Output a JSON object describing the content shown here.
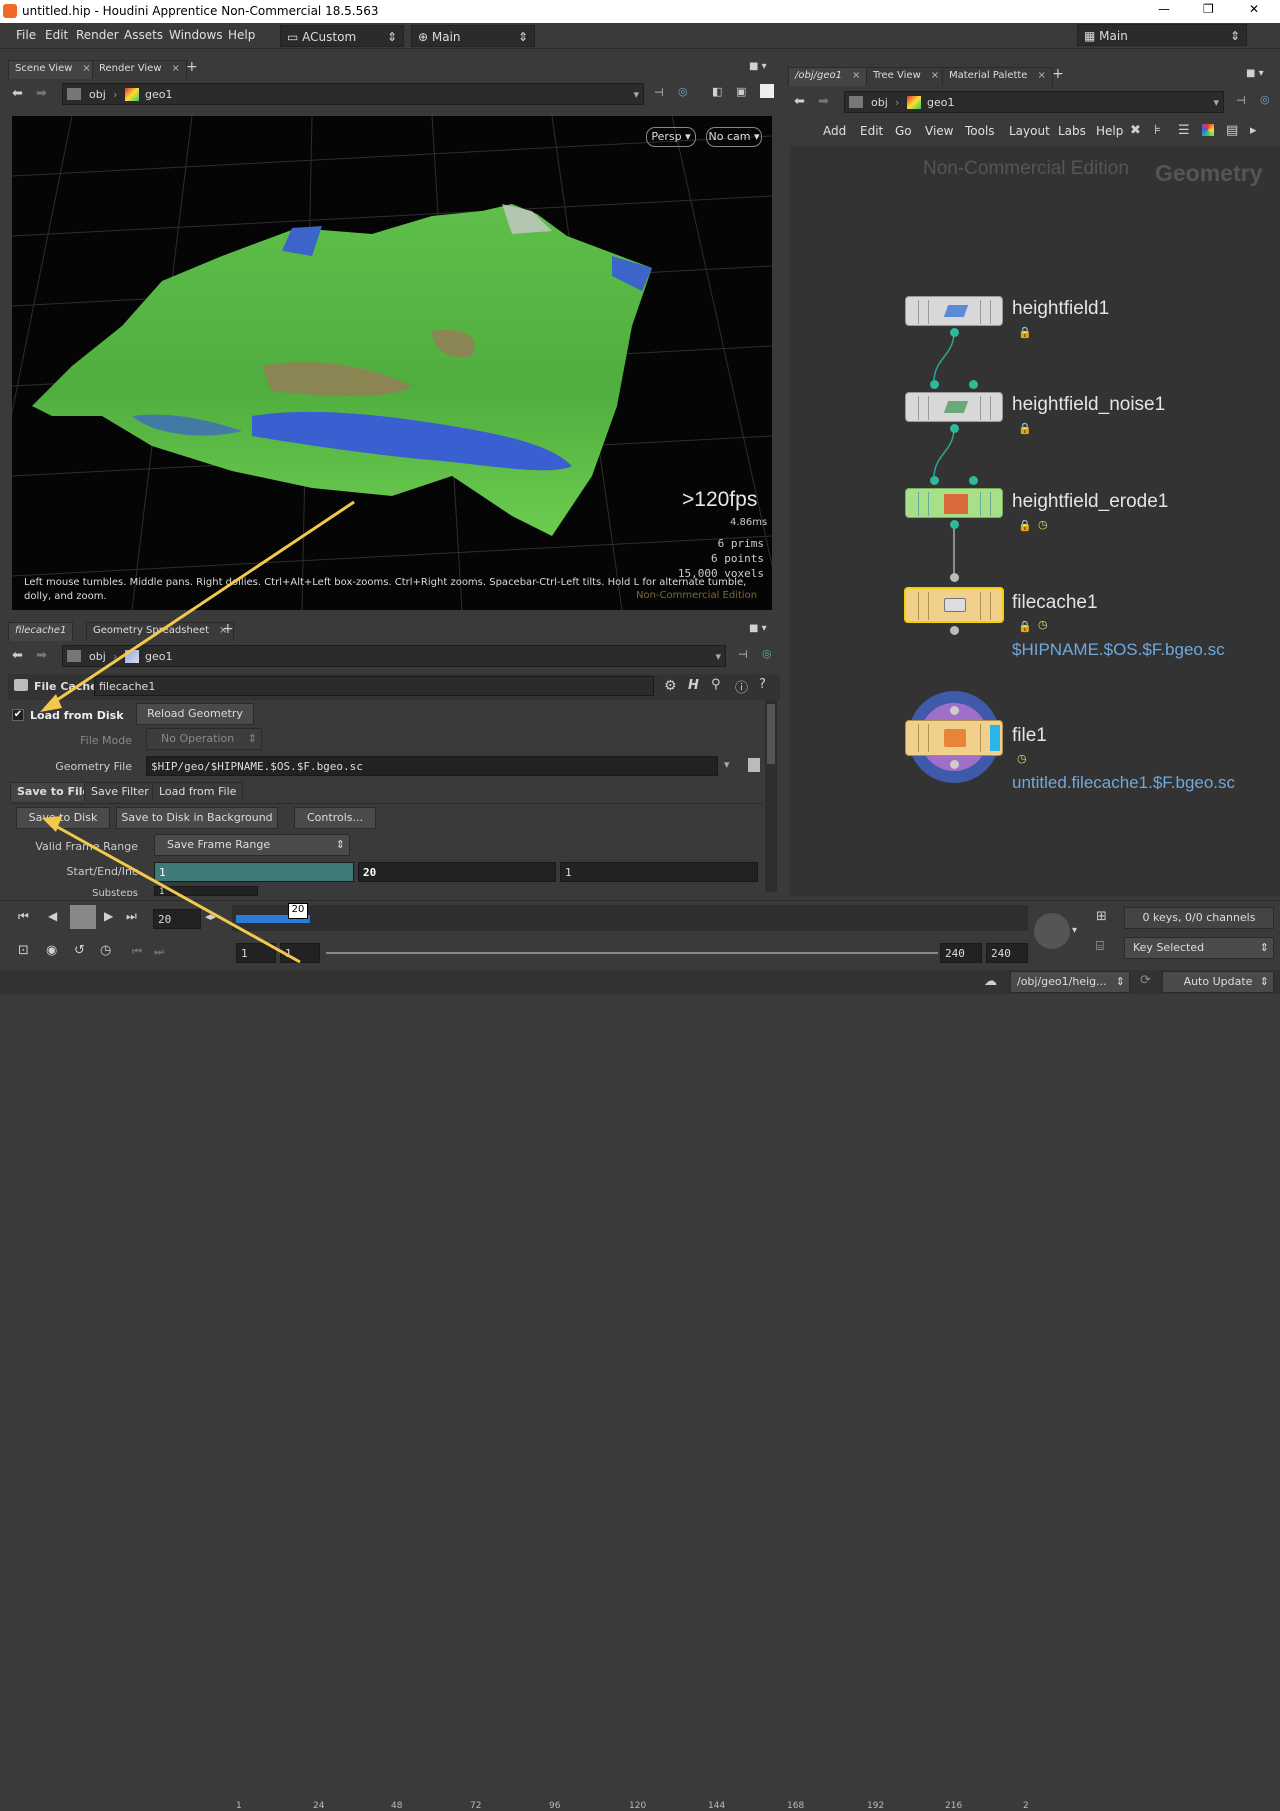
{
  "window": {
    "title": "untitled.hip - Houdini Apprentice Non-Commercial 18.5.563",
    "controls": [
      "—",
      "❐",
      "✕"
    ]
  },
  "menu": {
    "items": [
      "File",
      "Edit",
      "Render",
      "Assets",
      "Windows",
      "Help"
    ],
    "desktop": "ACustom",
    "context": "Main",
    "right_context": "Main"
  },
  "viewer": {
    "tabs": [
      "Scene View",
      "Render View"
    ],
    "path": {
      "root": "obj",
      "node": "geo1"
    },
    "persp": "Persp ▾",
    "cam": "No cam ▾",
    "fps": ">120fps",
    "ms": "4.86ms",
    "stats": [
      "6  prims",
      "6  points",
      "15,000 voxels"
    ],
    "hint": "Left mouse tumbles. Middle pans. Right dollies. Ctrl+Alt+Left box-zooms. Ctrl+Right zooms. Spacebar-Ctrl-Left tilts. Hold L for alternate tumble, dolly, and zoom.",
    "watermark": "Non-Commercial Edition"
  },
  "params": {
    "tabs": [
      "filecache1",
      "Geometry Spreadsheet"
    ],
    "path": {
      "root": "obj",
      "node": "geo1"
    },
    "node_type": "File Cache",
    "node_name": "filecache1",
    "load_from_disk": "Load from Disk",
    "reload_btn": "Reload Geometry",
    "file_mode_label": "File Mode",
    "file_mode_value": "No Operation",
    "geo_file_label": "Geometry File",
    "geo_file_value": "$HIP/geo/$HIPNAME.$OS.$F.bgeo.sc",
    "subtabs": [
      "Save to File",
      "Save Filter",
      "Load from File"
    ],
    "save_btn": "Save to Disk",
    "save_bg_btn": "Save to Disk in Background",
    "controls_btn": "Controls...",
    "valid_range_label": "Valid Frame Range",
    "valid_range_value": "Save Frame Range",
    "start_end_label": "Start/End/Inc",
    "start": "1",
    "end": "20",
    "inc": "1",
    "substeps_label": "Substeps",
    "substeps": "1"
  },
  "network": {
    "tabs": [
      "/obj/geo1",
      "Tree View",
      "Material Palette"
    ],
    "path": {
      "root": "obj",
      "node": "geo1"
    },
    "menu": [
      "Add",
      "Edit",
      "Go",
      "View",
      "Tools",
      "Layout",
      "Labs",
      "Help"
    ],
    "watermark": "Non-Commercial Edition",
    "context_label": "Geometry",
    "nodes": [
      {
        "name": "heightfield1",
        "expr": ""
      },
      {
        "name": "heightfield_noise1",
        "expr": ""
      },
      {
        "name": "heightfield_erode1",
        "expr": ""
      },
      {
        "name": "filecache1",
        "expr": "$HIPNAME.$OS.$F.bgeo.sc"
      },
      {
        "name": "file1",
        "expr": "untitled.filecache1.$F.bgeo.sc"
      }
    ]
  },
  "timeline": {
    "current_frame": "20",
    "marker": "20",
    "ticks": [
      "1",
      "24",
      "48",
      "72",
      "96",
      "120",
      "144",
      "168",
      "192",
      "216",
      "2"
    ],
    "start": "1",
    "start2": "1",
    "end": "240",
    "end2": "240",
    "keys_info": "0 keys, 0/0 channels",
    "key_mode": "Key Selected"
  },
  "status": {
    "path": "/obj/geo1/heig...",
    "update": "Auto Update"
  }
}
